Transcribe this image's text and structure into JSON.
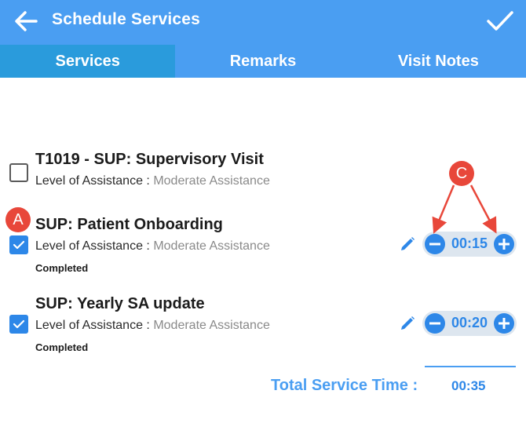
{
  "header": {
    "title": "Schedule Services"
  },
  "tabs": [
    {
      "label": "Services"
    },
    {
      "label": "Remarks"
    },
    {
      "label": "Visit Notes"
    }
  ],
  "services": [
    {
      "title": "T1019 - SUP: Supervisory Visit",
      "loa_label": "Level of Assistance :",
      "loa_value": "Moderate Assistance",
      "checked": false
    },
    {
      "title": "SUP: Patient Onboarding",
      "loa_label": "Level of Assistance :",
      "loa_value": "Moderate Assistance",
      "status": "Completed",
      "time": "00:15",
      "checked": true
    },
    {
      "title": "SUP: Yearly SA update",
      "loa_label": "Level of Assistance :",
      "loa_value": "Moderate Assistance",
      "status": "Completed",
      "time": "00:20",
      "checked": true
    }
  ],
  "total": {
    "label": "Total Service Time :",
    "value": "00:35"
  },
  "annotations": {
    "marker_a": "A",
    "marker_c": "C"
  },
  "colors": {
    "header_bg": "#4a9ef2",
    "active_tab_bg": "#2a9bdc",
    "accent": "#2d87e8",
    "annotation": "#e8473a"
  }
}
